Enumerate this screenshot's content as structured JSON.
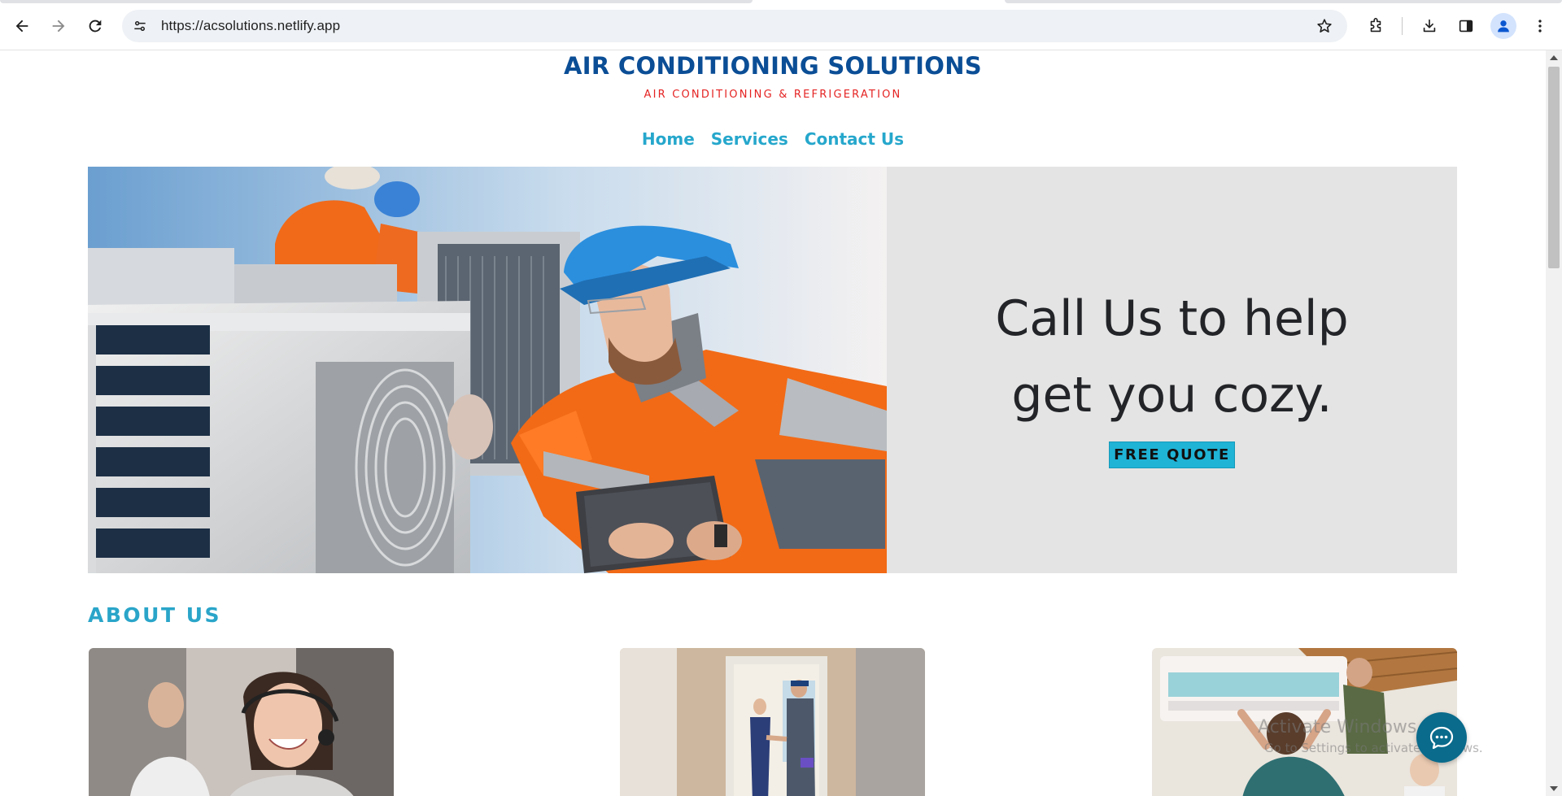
{
  "browser": {
    "url": "https://acsolutions.netlify.app",
    "icons": [
      "back-icon",
      "forward-icon",
      "reload-icon",
      "site-info-icon",
      "star-icon",
      "extensions-icon",
      "download-icon",
      "side-panel-icon",
      "profile-icon",
      "menu-icon"
    ]
  },
  "site": {
    "title": "AIR CONDITIONING SOLUTIONS",
    "subtitle": "AIR CONDITIONING & REFRIGERATION",
    "nav": [
      {
        "label": "Home"
      },
      {
        "label": "Services"
      },
      {
        "label": "Contact Us"
      }
    ]
  },
  "hero": {
    "heading_line1": "Call Us to help",
    "heading_line2": "get you cozy.",
    "cta_label": "FREE QUOTE"
  },
  "about": {
    "title": "ABOUT US"
  },
  "watermark": {
    "line1": "Activate Windows",
    "line2": "Go to Settings to activate Windows."
  },
  "colors": {
    "brand_blue": "#0b4e96",
    "brand_red": "#e52323",
    "accent_cyan": "#26a7cc",
    "cta": "#1fb3d6",
    "hero_panel": "#e4e4e4",
    "chat_fab": "#0a6b8c"
  }
}
